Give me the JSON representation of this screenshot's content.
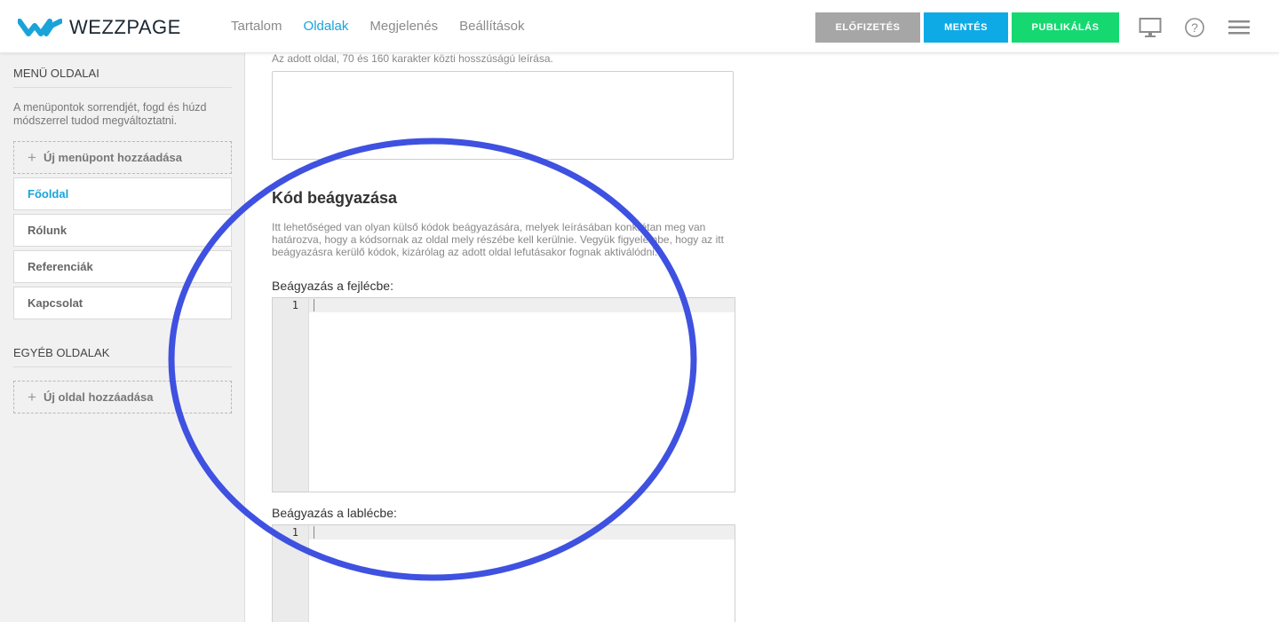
{
  "brand": {
    "name": "WEZZPAGE",
    "color": "#1aa3d9"
  },
  "nav": {
    "items": [
      "Tartalom",
      "Oldalak",
      "Megjelenés",
      "Beállítások"
    ],
    "active": "Oldalak"
  },
  "toolbar": {
    "subscription_label": "ELŐFIZETÉS",
    "save_label": "MENTÉS",
    "publish_label": "PUBLIKÁLÁS",
    "icons": [
      "desktop-preview-icon",
      "help-icon",
      "menu-icon"
    ]
  },
  "sidebar": {
    "menu_heading": "MENÜ OLDALAI",
    "menu_help": "A menüpontok sorrendjét, fogd és húzd módszerrel tudod megváltoztatni.",
    "add_menu_item_label": "Új menüpont hozzáadása",
    "items": [
      {
        "label": "Főoldal",
        "active": true
      },
      {
        "label": "Rólunk",
        "active": false
      },
      {
        "label": "Referenciák",
        "active": false
      },
      {
        "label": "Kapcsolat",
        "active": false
      }
    ],
    "other_heading": "EGYÉB OLDALAK",
    "add_page_label": "Új oldal hozzáadása"
  },
  "main": {
    "description_hint": "Az adott oldal, 70 és 160 karakter közti hosszúságú leírása.",
    "description_value": "",
    "code_section": {
      "title": "Kód beágyazása",
      "description": "Itt lehetőséged van olyan külső kódok beágyazására, melyek leírásában konkrétan meg van határozva, hogy a kódsornak az oldal mely részébe kell kerülnie. Vegyük figyelembe, hogy az itt beágyazásra kerülő kódok, kizárólag az adott oldal lefutásakor fognak aktiválódni.",
      "header_label": "Beágyazás a fejlécbe:",
      "header_line": "1",
      "footer_label": "Beágyazás a lablécbe:",
      "footer_line": "1"
    }
  },
  "colors": {
    "accent": "#1aa3d9",
    "subscription": "#a6a6a6",
    "save": "#0eaae6",
    "publish": "#15d970",
    "annotation": "#3f51e0"
  }
}
